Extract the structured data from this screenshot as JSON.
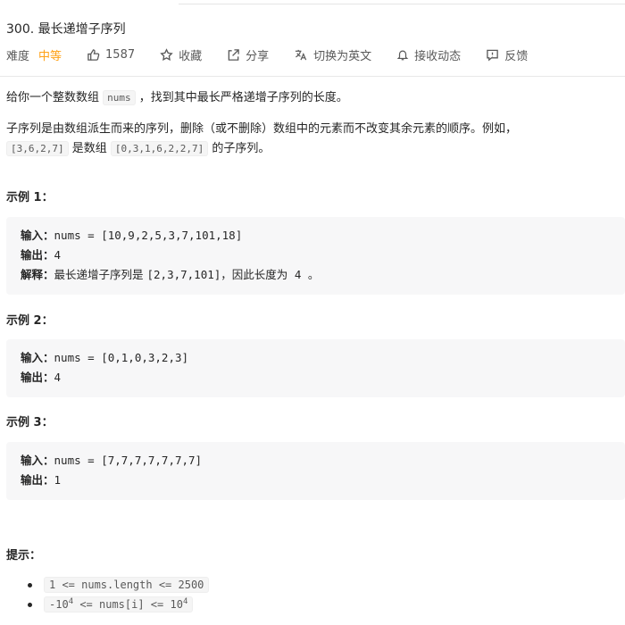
{
  "problem": {
    "title": "300. 最长递增子序列",
    "difficulty_label": "难度",
    "difficulty": "中等",
    "likes": "1587",
    "favorite_label": "收藏",
    "share_label": "分享",
    "switch_lang_label": "切换为英文",
    "subscribe_label": "接收动态",
    "feedback_label": "反馈"
  },
  "description": {
    "p1_before": "给你一个整数数组 ",
    "p1_code": "nums",
    "p1_after": " ，找到其中最长严格递增子序列的长度。",
    "p2_line1": "子序列是由数组派生而来的序列，删除（或不删除）数组中的元素而不改变其余元素的顺序。例如，",
    "p2_code1": "[3,6,2,7]",
    "p2_mid": " 是数组 ",
    "p2_code2": "[0,3,1,6,2,2,7]",
    "p2_after": " 的子序列。"
  },
  "examples": [
    {
      "heading": "示例 1：",
      "input_label": "输入：",
      "input": "nums = [10,9,2,5,3,7,101,18]",
      "output_label": "输出：",
      "output": "4",
      "explanation_label": "解释：",
      "explanation_pre": "最长递增子序列是 ",
      "explanation_code": "[2,3,7,101]",
      "explanation_post": "，因此长度为 4 。"
    },
    {
      "heading": "示例 2：",
      "input_label": "输入：",
      "input": "nums = [0,1,0,3,2,3]",
      "output_label": "输出：",
      "output": "4"
    },
    {
      "heading": "示例 3：",
      "input_label": "输入：",
      "input": "nums = [7,7,7,7,7,7,7]",
      "output_label": "输出：",
      "output": "1"
    }
  ],
  "hints": {
    "heading": "提示：",
    "c1": "1 <= nums.length <= 2500",
    "c2_prefix": "-10",
    "c2_exp1": "4",
    "c2_mid": " <= nums[i] <= 10",
    "c2_exp2": "4"
  },
  "colors": {
    "difficulty_medium": "#ffa116",
    "code_bg": "#f7f7f8"
  },
  "icons": [
    "thumbs-up-icon",
    "star-icon",
    "share-icon",
    "translate-icon",
    "bell-icon",
    "feedback-icon"
  ]
}
